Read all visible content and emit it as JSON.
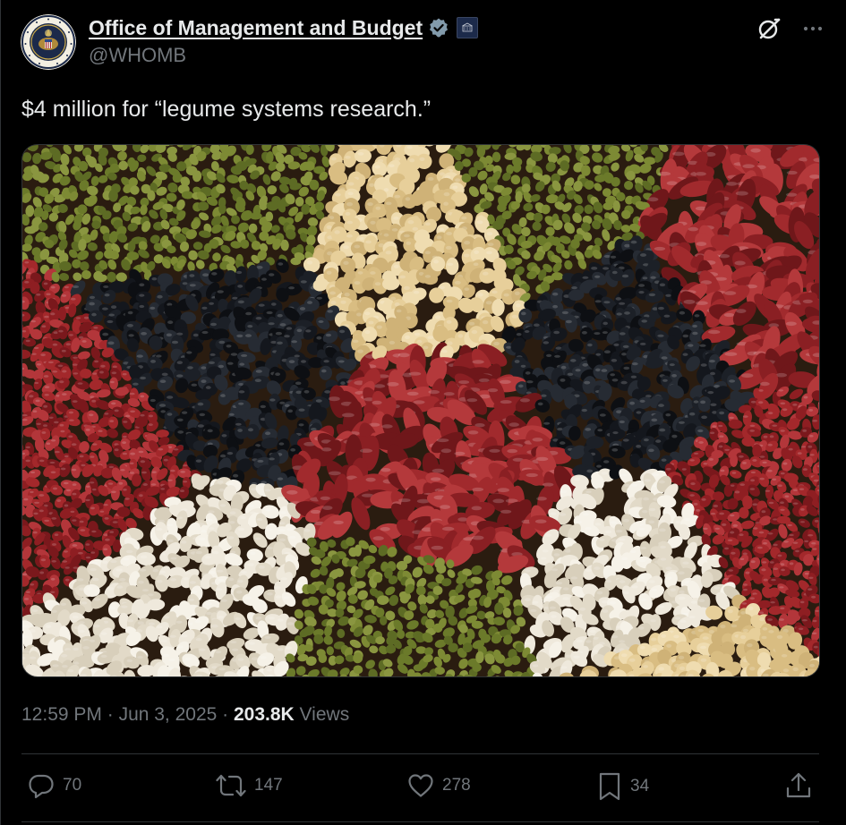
{
  "account": {
    "display_name": "Office of Management and Budget",
    "handle": "@WHOMB",
    "avatar_icon": "presidential-seal-icon",
    "verified_icon": "verified-badge-icon",
    "affiliate_icon": "white-house-badge-icon"
  },
  "header_actions": {
    "grok_icon": "grok-icon",
    "more_icon": "more-options-icon"
  },
  "tweet": {
    "text": "$4 million for “legume systems research.”",
    "media_icon": "legume-photo"
  },
  "meta": {
    "time": "12:59 PM",
    "separator1": " · ",
    "date": "Jun 3, 2025",
    "separator2": " · ",
    "views_count": "203.8K",
    "views_label": " Views"
  },
  "actions": {
    "reply": {
      "icon": "reply-icon",
      "count": "70"
    },
    "repost": {
      "icon": "repost-icon",
      "count": "147"
    },
    "like": {
      "icon": "like-icon",
      "count": "278"
    },
    "bookmark": {
      "icon": "bookmark-icon",
      "count": "34"
    },
    "share": {
      "icon": "share-icon"
    }
  },
  "colors": {
    "background": "#000000",
    "text_primary": "#e7e9ea",
    "text_secondary": "#71767b",
    "verified_badge": "#829aab",
    "divider": "#2f3336"
  }
}
